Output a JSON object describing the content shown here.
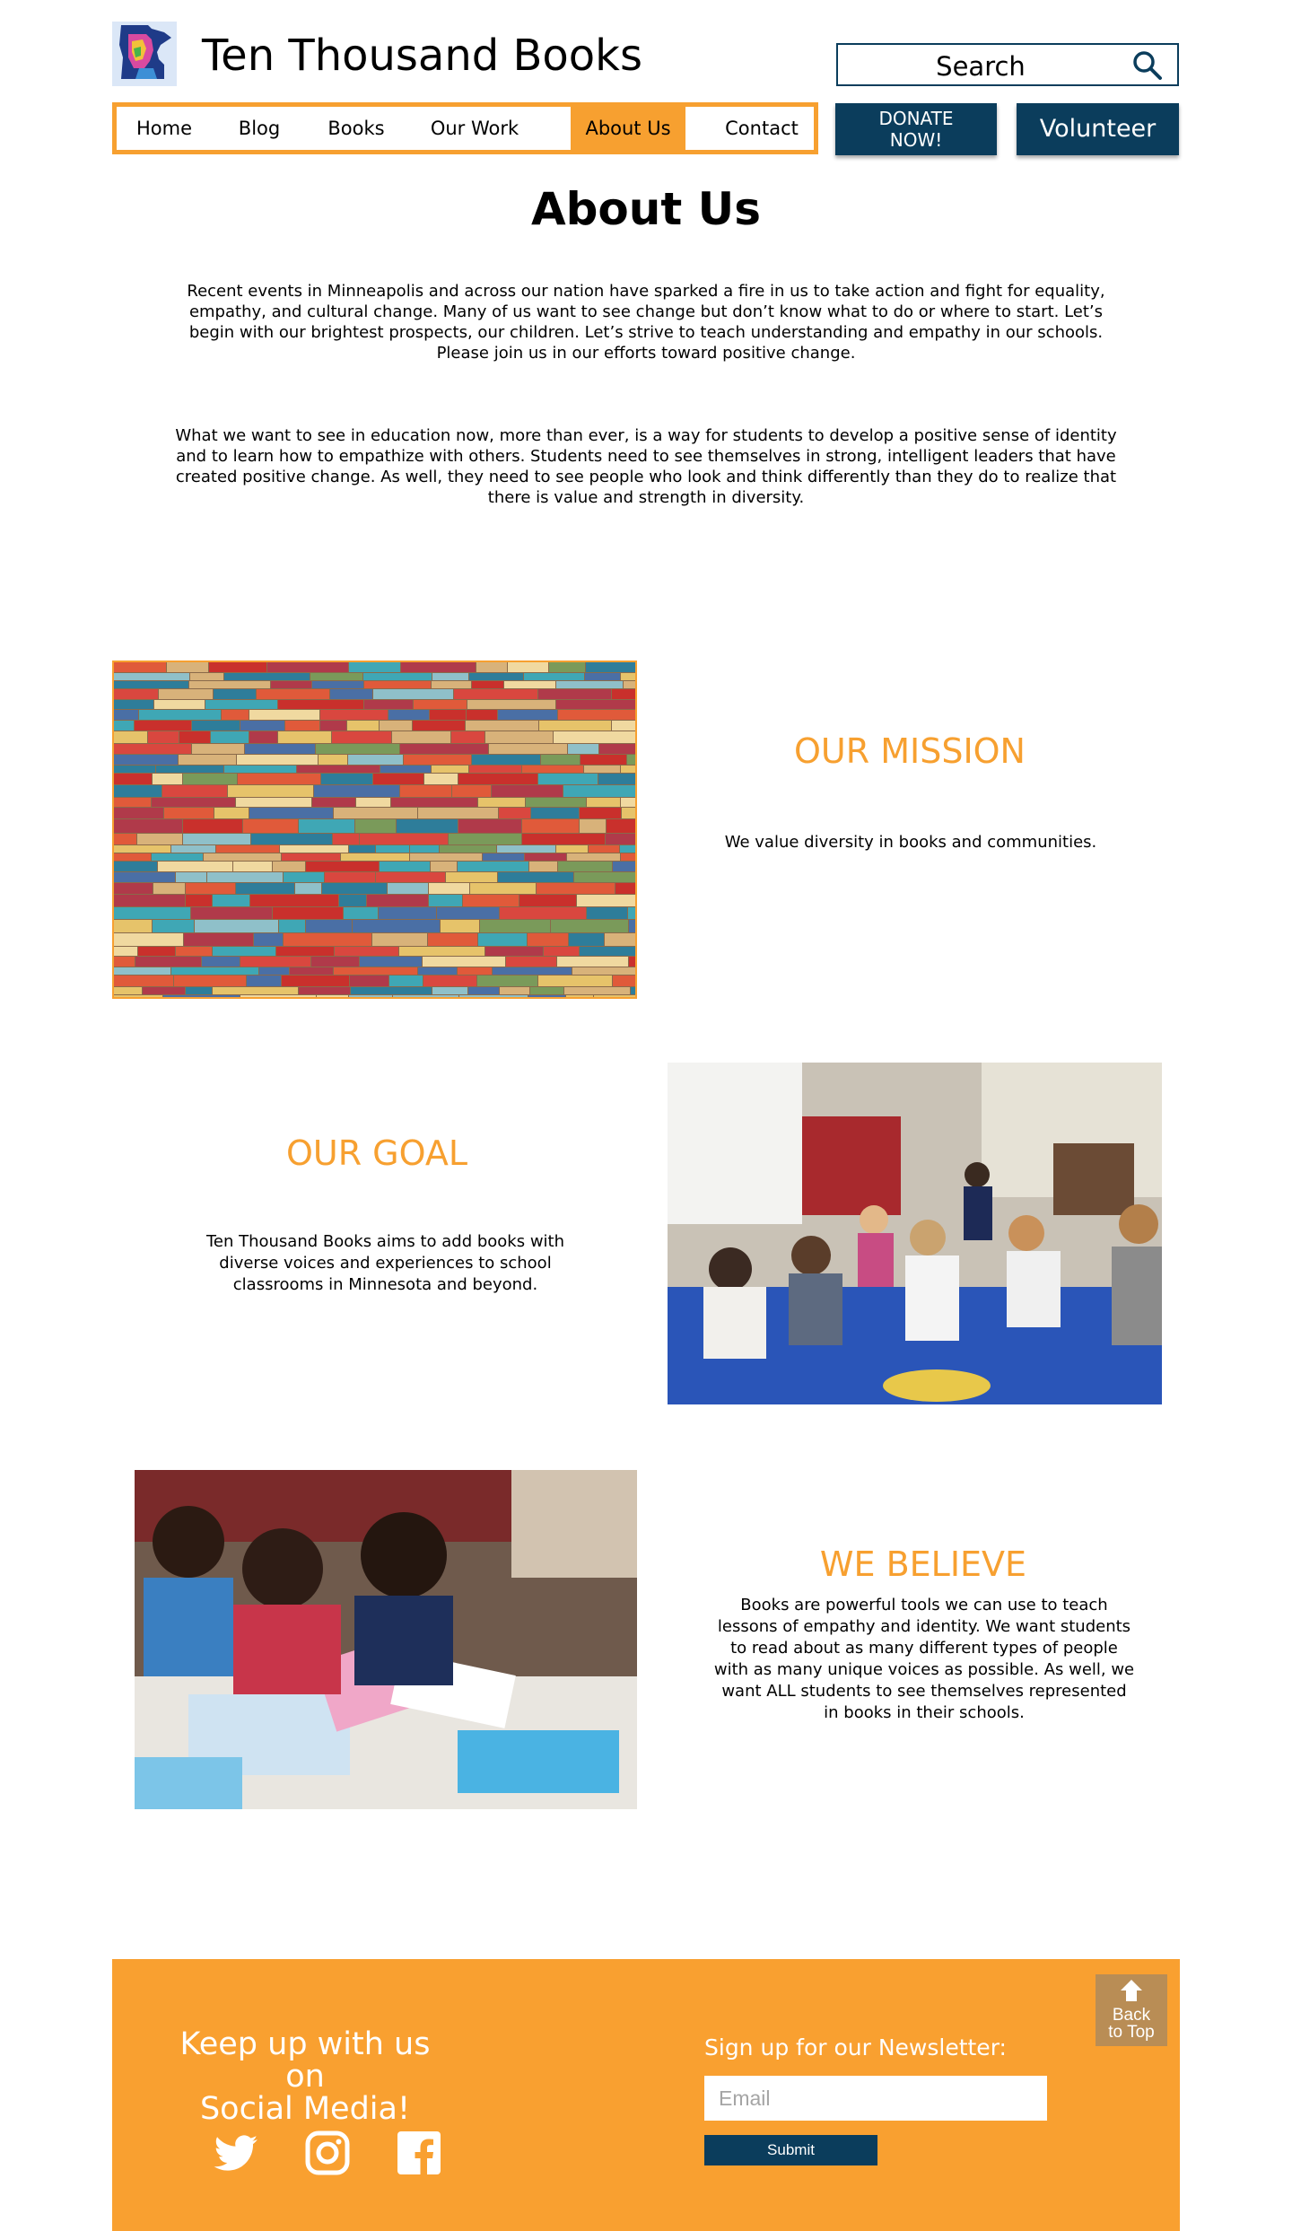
{
  "header": {
    "site_title": "Ten Thousand Books",
    "logo_icon": "minnesota-map-logo",
    "search": {
      "label": "Search",
      "icon": "search-icon"
    }
  },
  "nav": {
    "items": [
      {
        "label": "Home"
      },
      {
        "label": "Blog"
      },
      {
        "label": "Books"
      },
      {
        "label": "Our Work"
      },
      {
        "label": "About Us",
        "active": true
      },
      {
        "label": "Contact"
      }
    ]
  },
  "actions": {
    "donate_line1": "DONATE",
    "donate_line2": "NOW!",
    "volunteer": "Volunteer"
  },
  "main": {
    "title": "About Us",
    "intro_1": "Recent events in Minneapolis and across our nation have sparked a fire in us to take action and fight for equality, empathy, and cultural change. Many of us want to see change but don’t know what to do or where to start. Let’s begin with our brightest prospects, our children. Let’s strive to teach understanding and empathy in our schools. Please join us in our efforts toward positive change.",
    "intro_2": "What we want to see in education now, more than ever, is a way for students to develop a positive sense of identity and to learn how to empathize with others. Students need to see themselves in strong, intelligent leaders that have created positive change. As well, they need to see people who look and think differently than they do to realize that there is value and strength in diversity."
  },
  "sections": {
    "mission": {
      "heading": "OUR MISSION",
      "text": "We value diversity in books and communities."
    },
    "goal": {
      "heading": "OUR GOAL",
      "text": "Ten Thousand Books aims to add books with diverse voices and experiences to school classrooms in Minnesota and beyond."
    },
    "believe": {
      "heading": "WE BELIEVE",
      "text": "Books are powerful tools we can use to teach lessons of empathy and identity. We want students to read about as many different types of people with as many unique voices as possible. As well, we want ALL students to see themselves represented in books in their schools."
    }
  },
  "footer": {
    "social_title_line1": "Keep up with us on",
    "social_title_line2": "Social Media!",
    "newsletter_label": "Sign up for our Newsletter:",
    "email_placeholder": "Email",
    "submit": "Submit",
    "back_to_top_line1": "Back",
    "back_to_top_line2": "to Top",
    "social_icons": [
      "twitter-icon",
      "instagram-icon",
      "facebook-icon"
    ]
  },
  "colors": {
    "accent": "#f7a030",
    "navy": "#0b3d5c",
    "back_to_top": "#b98d55"
  }
}
